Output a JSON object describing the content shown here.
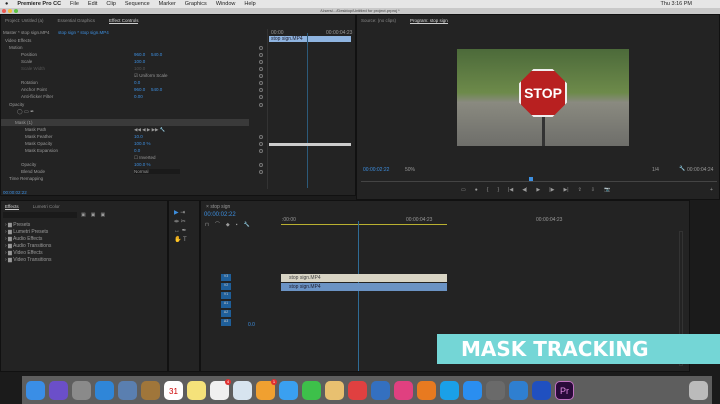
{
  "menubar": {
    "app": "Premiere Pro CC",
    "items": [
      "File",
      "Edit",
      "Clip",
      "Sequence",
      "Marker",
      "Graphics",
      "Window",
      "Help"
    ],
    "clock": "Thu 3:16 PM"
  },
  "titlebar": {
    "path": "/Users/.../Desktop/Untitled for project.prproj *"
  },
  "left_panel": {
    "tabs": [
      "Project: Untitled (a)",
      "Essential Graphics",
      "Effect Controls"
    ],
    "source": "Master * stop sign.MP4",
    "clip": "stop sign * stop sign.MP4",
    "section": "Video Effects",
    "motion": "Motion",
    "rows": [
      {
        "label": "Position",
        "v1": "960.0",
        "v2": "540.0"
      },
      {
        "label": "Scale",
        "v1": "100.0"
      },
      {
        "label": "Scale Width",
        "v1": "100.0"
      },
      {
        "label": "Uniform Scale"
      },
      {
        "label": "Rotation",
        "v1": "0.0"
      },
      {
        "label": "Anchor Point",
        "v1": "960.0",
        "v2": "540.0"
      },
      {
        "label": "Anti-flicker Filter",
        "v1": "0.00"
      }
    ],
    "opacity": "Opacity",
    "mask": "Mask (1)",
    "mask_rows": [
      {
        "label": "Mask Path"
      },
      {
        "label": "Mask Feather",
        "v1": "10.0"
      },
      {
        "label": "Mask Opacity",
        "v1": "100.0 %"
      },
      {
        "label": "Mask Expansion",
        "v1": "0.0"
      },
      {
        "label": "Inverted"
      },
      {
        "label": "Opacity",
        "v1": "100.0 %"
      },
      {
        "label": "Blend Mode",
        "v1": "Normal"
      }
    ],
    "time_remap": "Time Remapping",
    "timecode": "00:00:02:22",
    "mini_timeline": {
      "start": "00:00",
      "end": "00:00:04:23",
      "clip": "stop sign.MP4"
    }
  },
  "right_panel": {
    "tabs": [
      "Source: (no clips)",
      "Program: stop sign"
    ],
    "timecode": "00:00:02:22",
    "zoom": "50%",
    "quality": "1/4",
    "duration": "00:00:04:24",
    "sign_text": "STOP"
  },
  "effects_panel": {
    "tabs": [
      "Effects",
      "Lumetri Color"
    ],
    "folders": [
      "Presets",
      "Lumetri Presets",
      "Audio Effects",
      "Audio Transitions",
      "Video Effects",
      "Video Transitions"
    ]
  },
  "timeline": {
    "tab": "stop sign",
    "timecode": "00:00:02:22",
    "ruler": [
      ":00:00",
      "00:00:04:23"
    ],
    "clips": [
      "stop sign.MP4",
      "stop sign.MP4"
    ],
    "tracks": [
      "V3",
      "V2",
      "V1",
      "A1",
      "A2",
      "A3"
    ],
    "master": "0.0"
  },
  "banner": "MASK TRACKING",
  "dock": {
    "colors": [
      "#3a8ee6",
      "#6b4fc9",
      "#8a8a8a",
      "#2f86d8",
      "#5a7fb0",
      "#a0763a",
      "#ffffff",
      "#f5e27a",
      "#f0f0f0",
      "#d7e4ef",
      "#f0a030",
      "#3aa0f0",
      "#3dc04a",
      "#e8c070",
      "#e04040",
      "#3470c0",
      "#e04080",
      "#e87a20",
      "#1aa0e8",
      "#2a8ef0",
      "#6a6a6a",
      "#2f7fd0",
      "#2050c0",
      "#2a0a3a",
      "#bbbbbb"
    ],
    "badges": [
      "4",
      "1"
    ],
    "pr": "Pr",
    "calendar": "31"
  }
}
